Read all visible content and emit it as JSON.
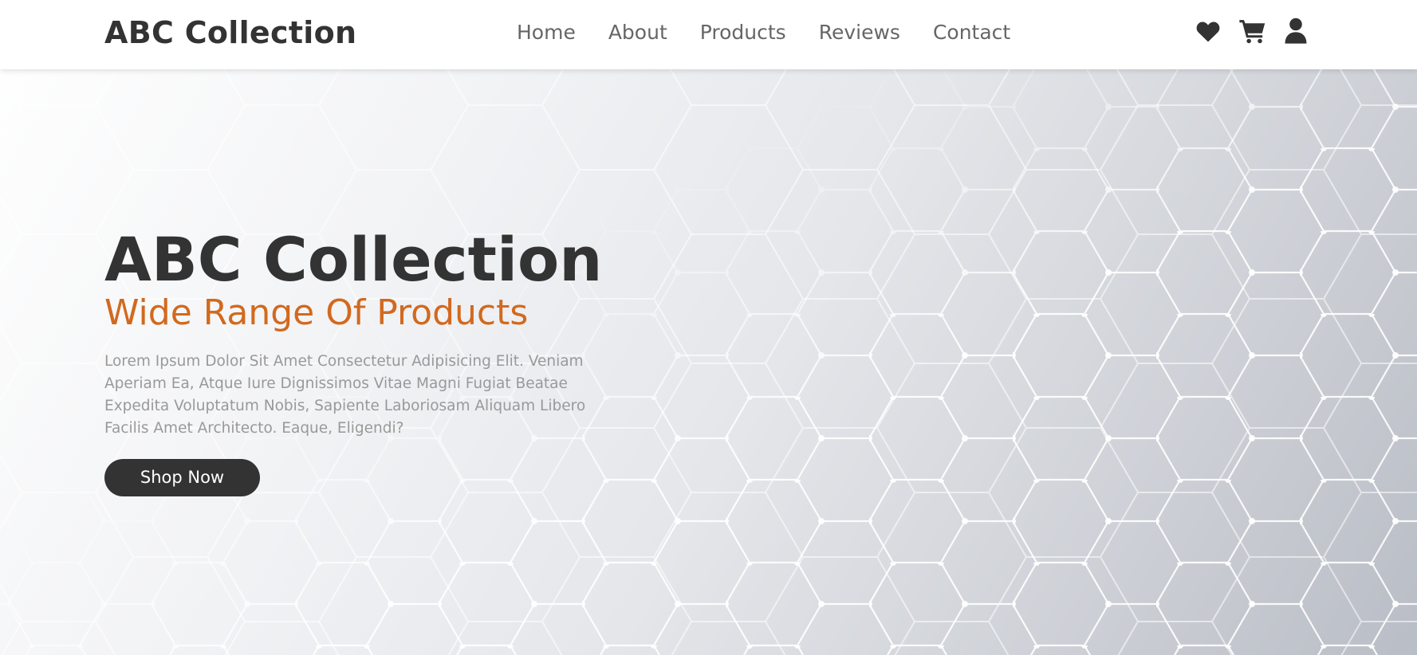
{
  "brand": {
    "name": "ABC Collection"
  },
  "nav": {
    "items": [
      {
        "label": "Home"
      },
      {
        "label": "About"
      },
      {
        "label": "Products"
      },
      {
        "label": "Reviews"
      },
      {
        "label": "Contact"
      }
    ],
    "icons": [
      "heart-icon",
      "cart-icon",
      "user-icon"
    ]
  },
  "hero": {
    "title": "ABC Collection",
    "subtitle": "Wide Range Of Products",
    "description": "Lorem Ipsum Dolor Sit Amet Consectetur Adipisicing Elit. Veniam Aperiam Ea, Atque Iure Dignissimos Vitae Magni Fugiat Beatae Expedita Voluptatum Nobis, Sapiente Laboriosam Aliquam Libero Facilis Amet Architecto. Eaque, Eligendi?",
    "cta_label": "Shop Now"
  },
  "colors": {
    "text_dark": "#333333",
    "accent": "#d2691e",
    "nav_text": "#666666",
    "body_text": "#999999",
    "header_bg": "#ffffff"
  }
}
